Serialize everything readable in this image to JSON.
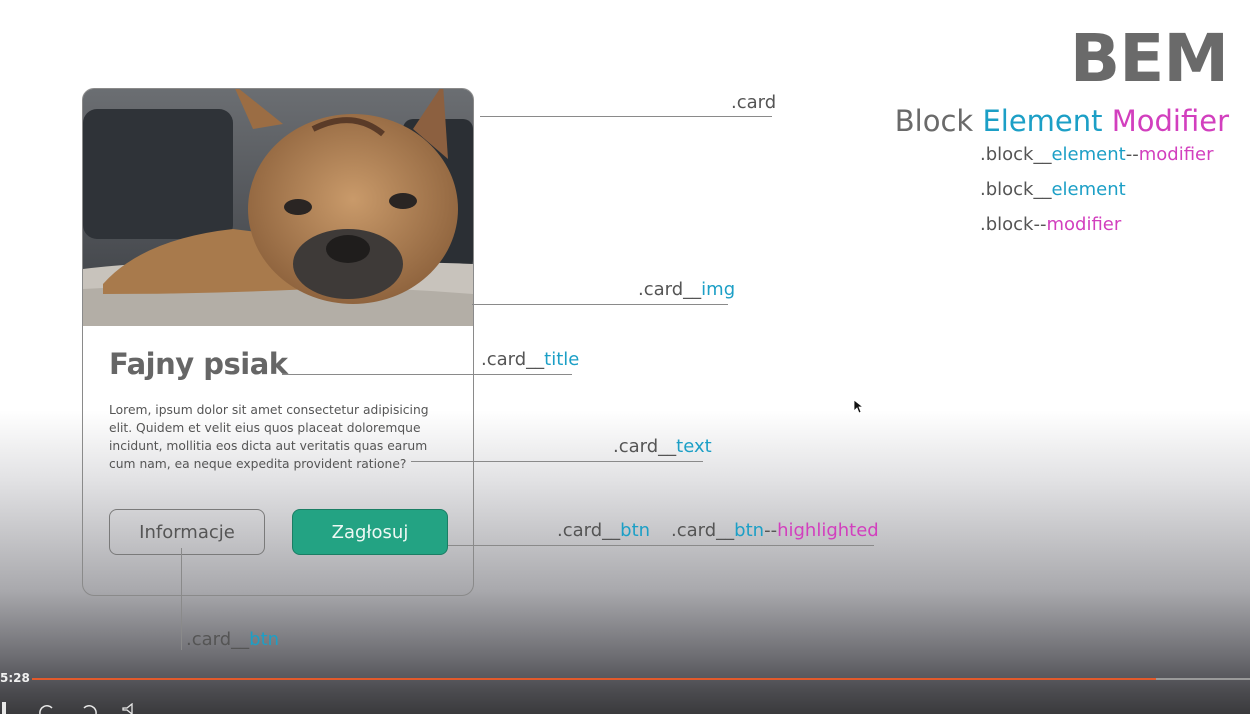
{
  "header": {
    "title": "BEM",
    "subtitle": {
      "block": "Block",
      "element": "Element",
      "modifier": "Modifier"
    },
    "examples": [
      {
        "block": ".block",
        "sep1": "__",
        "element": "element",
        "sep2": "--",
        "modifier": "modifier"
      },
      {
        "block": ".block",
        "sep1": "__",
        "element": "element"
      },
      {
        "block": ".block",
        "sep2": "--",
        "modifier": "modifier"
      }
    ]
  },
  "card": {
    "title": "Fajny psiak",
    "text": "Lorem, ipsum dolor sit amet consectetur adipisicing elit. Quidem et velit eius quos placeat doloremque incidunt, mollitia eos dicta aut veritatis quas earum cum nam, ea neque expedita provident ratione?",
    "buttons": {
      "info": "Informacje",
      "vote": "Zagłosuj"
    }
  },
  "labels": {
    "card": ".card",
    "img": {
      "prefix": ".card__",
      "element": "img"
    },
    "title": {
      "prefix": ".card__",
      "element": "title"
    },
    "text": {
      "prefix": ".card__",
      "element": "text"
    },
    "btn": {
      "prefix": ".card__",
      "element": "btn"
    },
    "btn_highlighted": {
      "prefix": ".card__",
      "element": "btn",
      "sep": "--",
      "modifier": "highlighted"
    },
    "btn_bottom": {
      "prefix": ".card__",
      "element": "btn"
    }
  },
  "player": {
    "time": "5:28",
    "progress": 0.923
  },
  "colors": {
    "element": "#1c9fc6",
    "modifier": "#d23fbe",
    "button_highlight": "#23a383",
    "progress": "#e25a2c"
  }
}
